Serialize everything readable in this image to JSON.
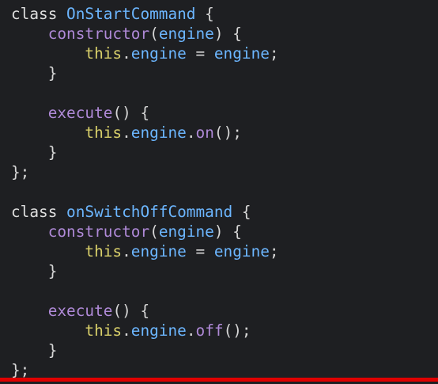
{
  "colors": {
    "background": "#1e1f22",
    "keyword": "#dedede",
    "class_name": "#6cb6ff",
    "method": "#b08ad8",
    "this": "#d8cf6a",
    "property": "#6cb6ff",
    "progress": "#e00000"
  },
  "code": {
    "lines": [
      [
        {
          "t": "class ",
          "c": "kw"
        },
        {
          "t": "OnStartCommand",
          "c": "class"
        },
        {
          "t": " {",
          "c": "punc"
        }
      ],
      [
        {
          "t": "    ",
          "c": "punc"
        },
        {
          "t": "constructor",
          "c": "fn"
        },
        {
          "t": "(",
          "c": "punc"
        },
        {
          "t": "engine",
          "c": "param"
        },
        {
          "t": ") {",
          "c": "punc"
        }
      ],
      [
        {
          "t": "        ",
          "c": "punc"
        },
        {
          "t": "this",
          "c": "this"
        },
        {
          "t": ".",
          "c": "punc"
        },
        {
          "t": "engine",
          "c": "prop"
        },
        {
          "t": " = ",
          "c": "op"
        },
        {
          "t": "engine",
          "c": "param"
        },
        {
          "t": ";",
          "c": "punc"
        }
      ],
      [
        {
          "t": "    }",
          "c": "punc"
        }
      ],
      [
        {
          "t": "",
          "c": "punc"
        }
      ],
      [
        {
          "t": "    ",
          "c": "punc"
        },
        {
          "t": "execute",
          "c": "fn"
        },
        {
          "t": "() {",
          "c": "punc"
        }
      ],
      [
        {
          "t": "        ",
          "c": "punc"
        },
        {
          "t": "this",
          "c": "this"
        },
        {
          "t": ".",
          "c": "punc"
        },
        {
          "t": "engine",
          "c": "prop"
        },
        {
          "t": ".",
          "c": "punc"
        },
        {
          "t": "on",
          "c": "fn"
        },
        {
          "t": "();",
          "c": "punc"
        }
      ],
      [
        {
          "t": "    }",
          "c": "punc"
        }
      ],
      [
        {
          "t": "};",
          "c": "punc"
        }
      ],
      [
        {
          "t": "",
          "c": "punc"
        }
      ],
      [
        {
          "t": "class ",
          "c": "kw"
        },
        {
          "t": "onSwitchOffCommand",
          "c": "class"
        },
        {
          "t": " {",
          "c": "punc"
        }
      ],
      [
        {
          "t": "    ",
          "c": "punc"
        },
        {
          "t": "constructor",
          "c": "fn"
        },
        {
          "t": "(",
          "c": "punc"
        },
        {
          "t": "engine",
          "c": "param"
        },
        {
          "t": ") {",
          "c": "punc"
        }
      ],
      [
        {
          "t": "        ",
          "c": "punc"
        },
        {
          "t": "this",
          "c": "this"
        },
        {
          "t": ".",
          "c": "punc"
        },
        {
          "t": "engine",
          "c": "prop"
        },
        {
          "t": " = ",
          "c": "op"
        },
        {
          "t": "engine",
          "c": "param"
        },
        {
          "t": ";",
          "c": "punc"
        }
      ],
      [
        {
          "t": "    }",
          "c": "punc"
        }
      ],
      [
        {
          "t": "",
          "c": "punc"
        }
      ],
      [
        {
          "t": "    ",
          "c": "punc"
        },
        {
          "t": "execute",
          "c": "fn"
        },
        {
          "t": "() {",
          "c": "punc"
        }
      ],
      [
        {
          "t": "        ",
          "c": "punc"
        },
        {
          "t": "this",
          "c": "this"
        },
        {
          "t": ".",
          "c": "punc"
        },
        {
          "t": "engine",
          "c": "prop"
        },
        {
          "t": ".",
          "c": "punc"
        },
        {
          "t": "off",
          "c": "fn"
        },
        {
          "t": "();",
          "c": "punc"
        }
      ],
      [
        {
          "t": "    }",
          "c": "punc"
        }
      ],
      [
        {
          "t": "};",
          "c": "punc"
        }
      ]
    ]
  },
  "video": {
    "progress_fraction": 1.0
  }
}
